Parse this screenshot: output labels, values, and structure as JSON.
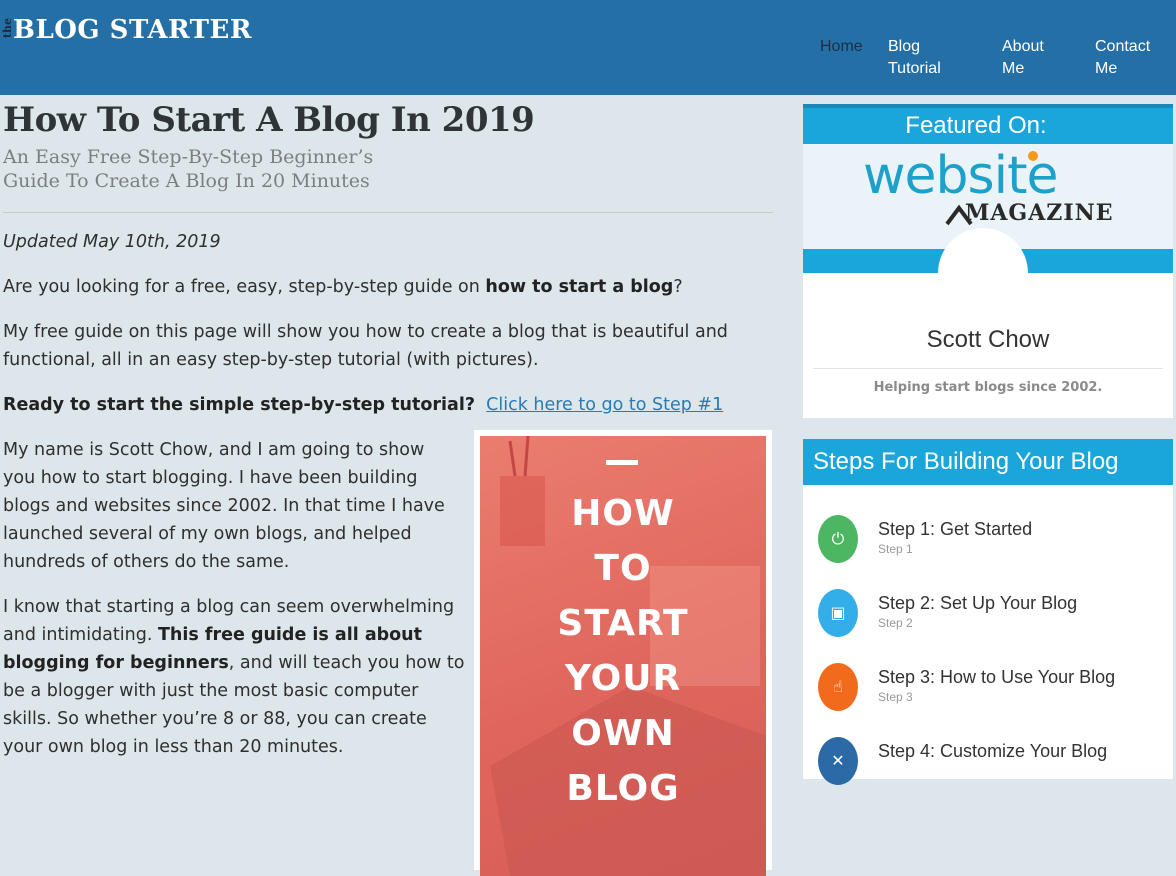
{
  "header": {
    "logo_small": "the",
    "logo_main": "BLOG STARTER",
    "nav": [
      {
        "label": "Home"
      },
      {
        "label": "Blog Tutorial"
      },
      {
        "label": "About Me"
      },
      {
        "label": "Contact Me"
      }
    ]
  },
  "article": {
    "title": "How To Start A Blog In 2019",
    "subtitle": "An Easy Free Step-By-Step Beginner’s Guide To Create A Blog In 20 Minutes",
    "updated": "Updated May 10th, 2019",
    "p1_a": "Are you looking for a free, easy, step-by-step guide on ",
    "p1_b": "how to start a blog",
    "p1_c": "?",
    "p2": "My free guide on this page will show you how to create a blog that is beautiful and functional, all in an easy step-by-step tutorial (with pictures).",
    "p3_bold": "Ready to start the simple step-by-step tutorial?",
    "p3_link": "Click here to go to Step #1",
    "p4": "My name is Scott Chow, and I am going to show you how to start blogging. I have been building blogs and websites since 2002. In that time I have launched several of my own blogs, and helped hundreds of others do the same.",
    "p5_a": "I know that starting a blog can seem overwhelming and intimidating. ",
    "p5_b": "This free guide is all about blogging for beginners",
    "p5_c": ", and will teach you how to be a blogger with just the most basic computer skills. So whether you’re 8 or 88, you can create your own blog in less than 20 minutes.",
    "image_text": [
      "HOW",
      "TO",
      "START",
      "YOUR",
      "OWN",
      "BLOG"
    ]
  },
  "sidebar": {
    "featured_title": "Featured On:",
    "featured_logo_top": "website",
    "featured_logo_bottom": "MAGAZINE",
    "author_name": "Scott Chow",
    "author_tagline": "Helping start blogs since 2002.",
    "steps_title": "Steps For Building Your Blog",
    "steps": [
      {
        "title": "Step 1: Get Started",
        "sub": "Step 1",
        "icon": "power-icon",
        "color": "#4cb663"
      },
      {
        "title": "Step 2: Set Up Your Blog",
        "sub": "Step 2",
        "icon": "setup-icon",
        "color": "#33aee8"
      },
      {
        "title": "Step 3: How to Use Your Blog",
        "sub": "Step 3",
        "icon": "touch-icon",
        "color": "#f26b1d"
      },
      {
        "title": "Step 4: Customize Your Blog",
        "sub": "",
        "icon": "tools-icon",
        "color": "#2b6aa5"
      }
    ]
  },
  "colors": {
    "header_bg": "#2470a6",
    "page_bg": "#dde6ea",
    "accent": "#1aa5db",
    "link": "#2a7ab3"
  }
}
